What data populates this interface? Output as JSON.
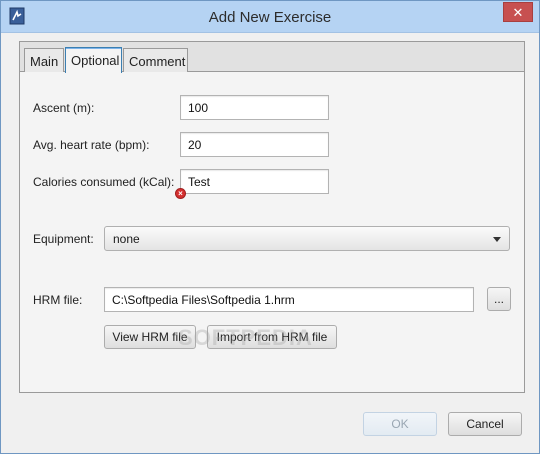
{
  "window": {
    "title": "Add New Exercise",
    "close_label": "✕",
    "app_icon": "app-icon"
  },
  "tabs": [
    {
      "label": "Main",
      "active": false
    },
    {
      "label": "Optional",
      "active": true
    },
    {
      "label": "Comment",
      "active": false
    }
  ],
  "fields": {
    "ascent": {
      "label": "Ascent (m):",
      "value": "100"
    },
    "heart_rate": {
      "label": "Avg. heart rate (bpm):",
      "value": "20"
    },
    "calories": {
      "label": "Calories consumed (kCal):",
      "value": "Test",
      "error": true
    }
  },
  "equipment": {
    "label": "Equipment:",
    "value": "none"
  },
  "hrm": {
    "label": "HRM file:",
    "value": "C:\\Softpedia Files\\Softpedia 1.hrm",
    "browse_label": "...",
    "view_label": "View HRM file",
    "import_label": "Import from HRM file"
  },
  "footer": {
    "ok_label": "OK",
    "cancel_label": "Cancel"
  },
  "watermark": "SOFTPEDIA",
  "colors": {
    "titlebar": "#b5d3f3",
    "close": "#c75050",
    "error": "#d43030"
  }
}
